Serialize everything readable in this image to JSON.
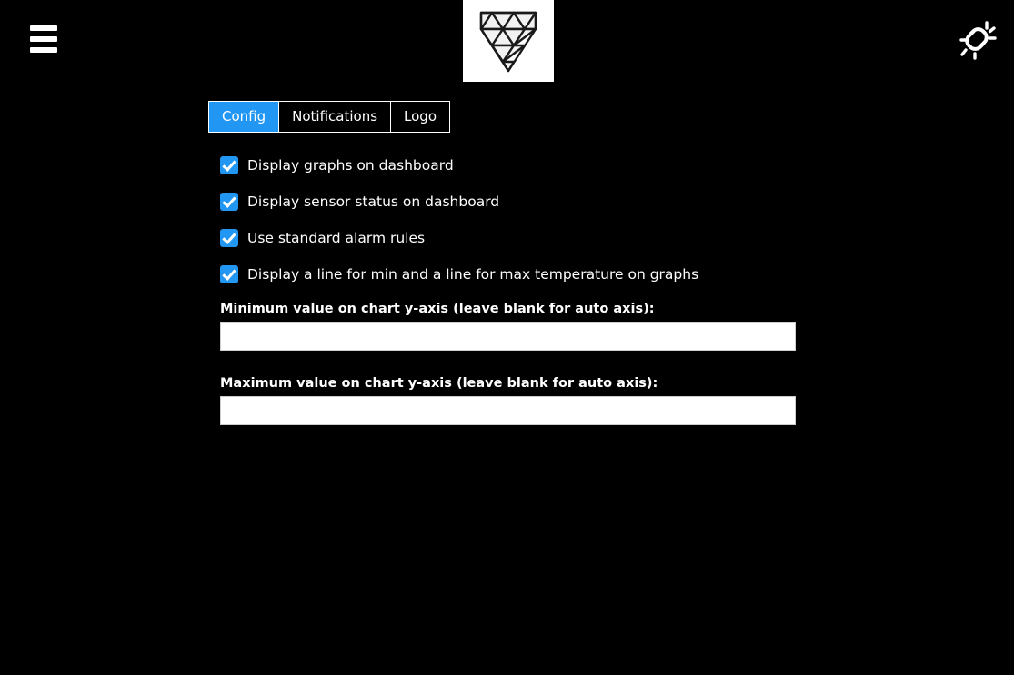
{
  "header": {
    "menu_icon": "hamburger-menu-icon",
    "logo_icon": "diamond-logo-icon",
    "status_icon": "broken-link-icon"
  },
  "tabs": [
    {
      "label": "Config",
      "active": true
    },
    {
      "label": "Notifications",
      "active": false
    },
    {
      "label": "Logo",
      "active": false
    }
  ],
  "config": {
    "checkboxes": [
      {
        "label": "Display graphs on dashboard",
        "checked": true
      },
      {
        "label": "Display sensor status on dashboard",
        "checked": true
      },
      {
        "label": "Use standard alarm rules",
        "checked": true
      },
      {
        "label": "Display a line for min and a line for max temperature on graphs",
        "checked": true
      }
    ],
    "minimum_axis": {
      "label": "Minimum value on chart y-axis (leave blank for auto axis):",
      "value": "",
      "placeholder": ""
    },
    "maximum_axis": {
      "label": "Maximum value on chart y-axis (leave blank for auto axis):",
      "value": "",
      "placeholder": ""
    }
  },
  "colors": {
    "background": "#000000",
    "accent": "#2196f3",
    "text": "#ffffff",
    "input_background": "#ffffff"
  }
}
